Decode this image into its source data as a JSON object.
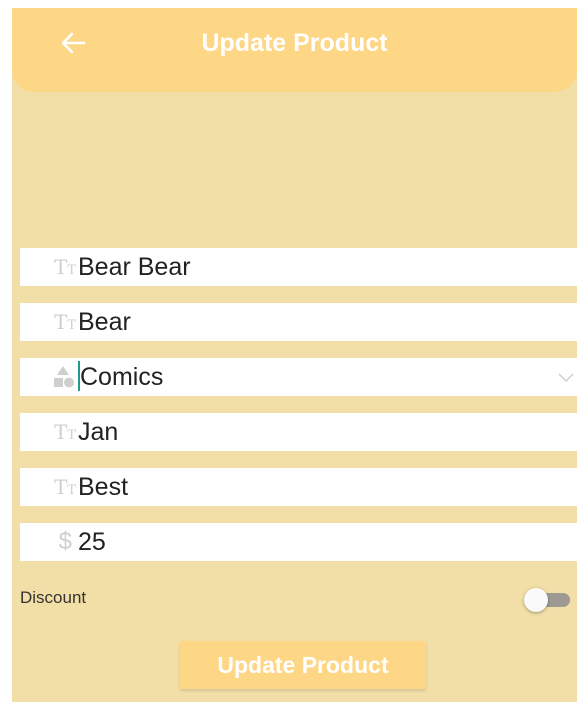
{
  "header": {
    "title": "Update Product",
    "back_icon": "arrow-left-icon"
  },
  "form": {
    "fields": [
      {
        "name": "title",
        "icon": "text-format-icon",
        "value": "Bear Bear"
      },
      {
        "name": "author",
        "icon": "text-format-icon",
        "value": "Bear"
      },
      {
        "name": "category",
        "icon": "category-shapes-icon",
        "value": "Comics",
        "type": "select"
      },
      {
        "name": "publisher",
        "icon": "text-format-icon",
        "value": "Jan"
      },
      {
        "name": "description",
        "icon": "text-format-icon",
        "value": "Best"
      },
      {
        "name": "price",
        "icon": "dollar-icon",
        "value": "25"
      }
    ],
    "discount": {
      "label": "Discount",
      "enabled": false
    },
    "submit_label": "Update Product"
  },
  "colors": {
    "background": "#f2dfa7",
    "appbar": "#fdd686",
    "field_bg": "#ffffff",
    "caret": "#1f9a8c"
  }
}
